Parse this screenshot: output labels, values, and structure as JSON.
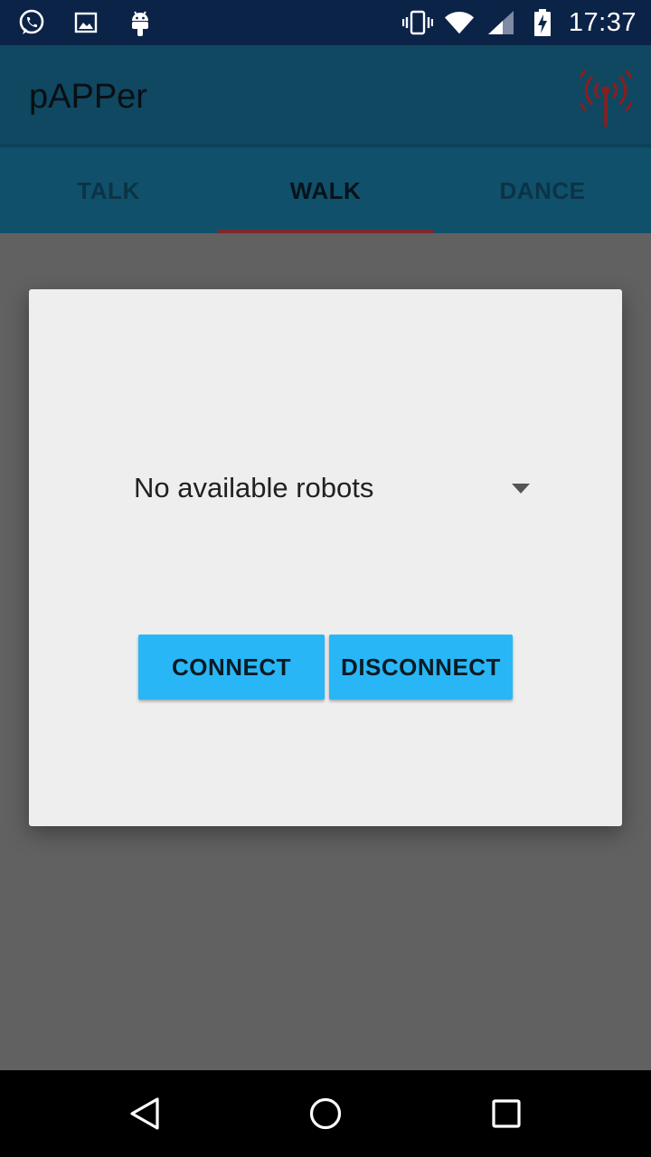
{
  "status_bar": {
    "time": "17:37",
    "left_icons": [
      "whatsapp-icon",
      "image-icon",
      "android-icon"
    ],
    "right_icons": [
      "vibrate-icon",
      "wifi-icon",
      "signal-icon",
      "battery-charging-icon"
    ]
  },
  "app_bar": {
    "title": "pAPPer",
    "action_icon": "antenna-icon",
    "action_icon_color": "#8b1e1e"
  },
  "tabs": [
    {
      "label": "TALK",
      "active": false
    },
    {
      "label": "WALK",
      "active": true
    },
    {
      "label": "DANCE",
      "active": false
    }
  ],
  "dialog": {
    "spinner": {
      "selected": "No available robots"
    },
    "connect_label": "CONNECT",
    "disconnect_label": "DISCONNECT",
    "button_color": "#29b6f6"
  },
  "nav_bar": {
    "icons": [
      "back-icon",
      "home-icon",
      "recents-icon"
    ]
  }
}
